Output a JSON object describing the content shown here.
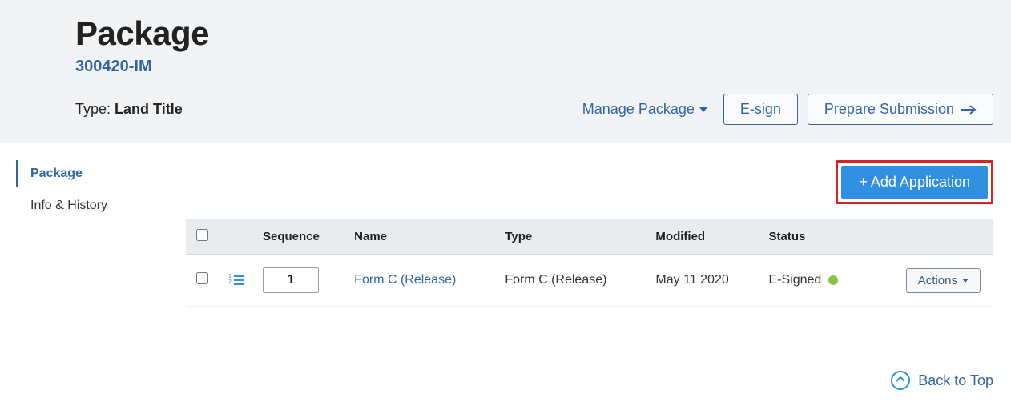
{
  "header": {
    "title": "Package",
    "package_id": "300420-IM",
    "type_prefix": "Type: ",
    "type_value": "Land Title",
    "manage_label": "Manage Package",
    "esign_label": "E-sign",
    "prepare_label": "Prepare Submission"
  },
  "sidebar": {
    "items": [
      {
        "label": "Package",
        "active": true
      },
      {
        "label": "Info & History",
        "active": false
      }
    ]
  },
  "main": {
    "add_application_label": "+ Add Application",
    "columns": {
      "sequence": "Sequence",
      "name": "Name",
      "type": "Type",
      "modified": "Modified",
      "status": "Status"
    },
    "rows": [
      {
        "sequence": "1",
        "name": "Form C (Release)",
        "type": "Form C (Release)",
        "modified": "May 11 2020",
        "status": "E-Signed",
        "actions_label": "Actions"
      }
    ]
  },
  "footer": {
    "back_to_top": "Back to Top"
  },
  "colors": {
    "primary": "#3266a3",
    "button_primary_bg": "#2f8fe0",
    "highlight_border": "#d62324",
    "status_green": "#8bc34a"
  }
}
